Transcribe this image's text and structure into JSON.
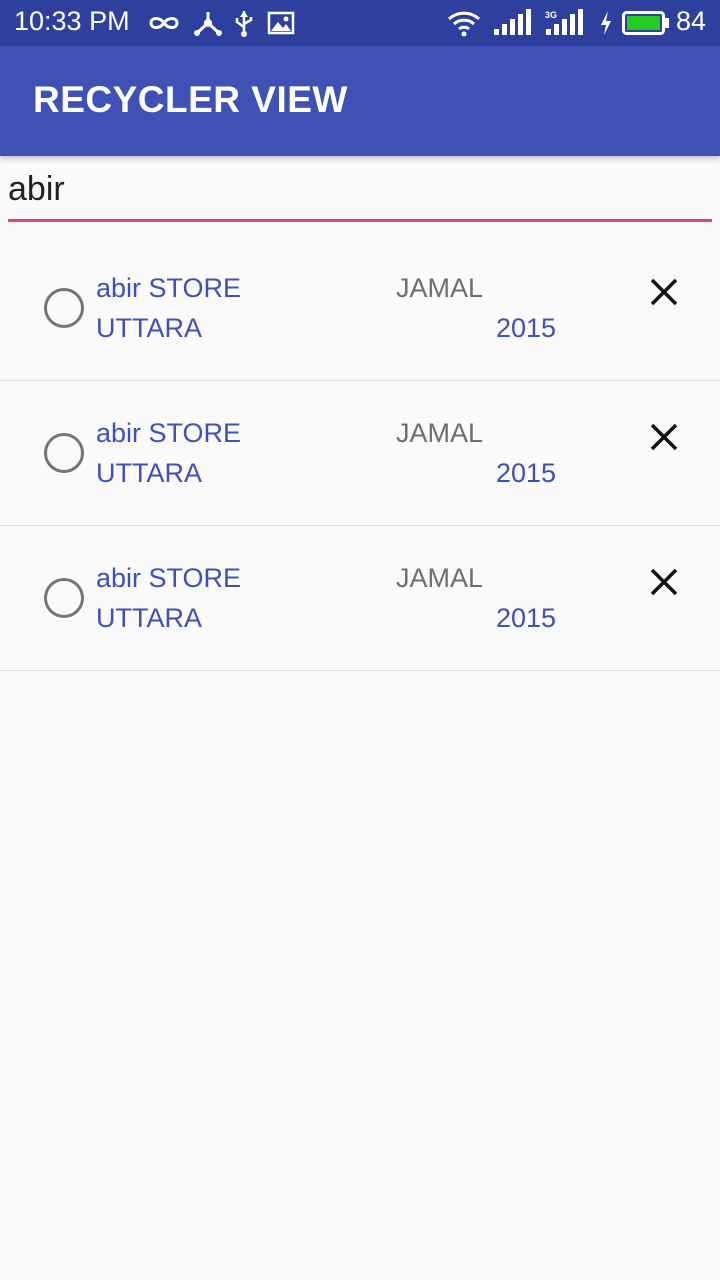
{
  "status_bar": {
    "time": "10:33 PM",
    "battery_level": "84",
    "left_icons": [
      "infinity-icon",
      "network-hub-icon",
      "usb-icon",
      "image-icon"
    ],
    "right_icons": [
      "wifi-icon",
      "signal-icon",
      "signal-3g-icon",
      "charging-icon",
      "battery-icon"
    ],
    "battery_color": "#22cc22"
  },
  "app_bar": {
    "title": "RECYCLER VIEW",
    "color": "#3f51b5"
  },
  "search": {
    "value": "abir",
    "underline_color": "#e0457b"
  },
  "items": [
    {
      "store": "abir STORE",
      "owner": "JAMAL",
      "area": "UTTARA",
      "year": "2015"
    },
    {
      "store": "abir STORE",
      "owner": "JAMAL",
      "area": "UTTARA",
      "year": "2015"
    },
    {
      "store": "abir STORE",
      "owner": "JAMAL",
      "area": "UTTARA",
      "year": "2015"
    }
  ]
}
